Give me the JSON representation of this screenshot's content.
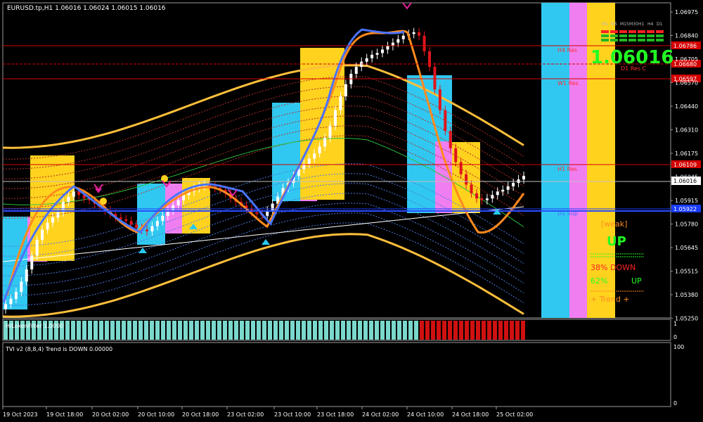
{
  "header": {
    "symbol_info": "EURUSD.tp,H1  1.06016 1.06024 1.06015 1.06016"
  },
  "price_axis": {
    "ticks": [
      "1.06975",
      "1.06840",
      "1.06705",
      "1.06570",
      "1.06440",
      "1.06310",
      "1.06175",
      "1.06045",
      "1.05915",
      "1.05780",
      "1.05645",
      "1.05515",
      "1.05380",
      "1.05250"
    ],
    "current_price": "1.06016"
  },
  "levels": [
    {
      "name": "H4 Res",
      "price": "1.06786",
      "color": "#d40000",
      "label": "H4 Res"
    },
    {
      "name": "D1 Res C",
      "price": "1.06680",
      "color": "#d40000",
      "label": "D1 Res C"
    },
    {
      "name": "W1 Res",
      "price": "1.06597",
      "color": "#d40000",
      "label": "W1 Res"
    },
    {
      "name": "H1 Res",
      "price": "1.06109",
      "color": "#d40000",
      "label": "H1 Res"
    },
    {
      "name": "D1 Sup",
      "price": "1.05922",
      "color": "#1a3cff",
      "label": "D1 Sup"
    }
  ],
  "big_price": "1.06016",
  "timeframes": [
    "M1",
    "M5",
    "M15",
    "M30",
    "H1",
    "H4",
    "D1"
  ],
  "signal_panel": {
    "weak": "[weak]",
    "up_big": "UP",
    "down_line": "38%  DOWN",
    "pct_up": "62%",
    "up_small": "UP",
    "trend": "+ Trend +"
  },
  "hilo": {
    "label": "HiLokenFilter 1.0000",
    "axis": [
      "1",
      "0"
    ]
  },
  "tvi": {
    "label": "TVI v2 (8,8,4) Trend is DOWN 0.00000",
    "axis": [
      "100",
      "0"
    ]
  },
  "time_axis": [
    "19 Oct 2023",
    "19 Oct 18:00",
    "20 Oct 02:00",
    "20 Oct 10:00",
    "20 Oct 18:00",
    "23 Oct 02:00",
    "23 Oct 10:00",
    "23 Oct 18:00",
    "24 Oct 02:00",
    "24 Oct 10:00",
    "24 Oct 18:00",
    "25 Oct 02:00"
  ],
  "chart_data": {
    "type": "candlestick",
    "title": "EURUSD.tp,H1",
    "y_range": [
      1.052,
      1.0702
    ],
    "close_series": [
      1.0528,
      1.0531,
      1.0535,
      1.0541,
      1.0548,
      1.0556,
      1.0565,
      1.0571,
      1.0575,
      1.0578,
      1.0581,
      1.0587,
      1.059,
      1.0593,
      1.0591,
      1.0589,
      1.0588,
      1.0586,
      1.0584,
      1.0582,
      1.058,
      1.0578,
      1.0577,
      1.0576,
      1.0574,
      1.0572,
      1.0571,
      1.057,
      1.0573,
      1.0576,
      1.0579,
      1.0582,
      1.0585,
      1.0588,
      1.0591,
      1.0593,
      1.0595,
      1.0596,
      1.0597,
      1.0596,
      1.0595,
      1.0594,
      1.0592,
      1.0589,
      1.0587,
      1.0585,
      1.0583,
      1.0581,
      1.058,
      1.0579,
      1.0582,
      1.0586,
      1.059,
      1.0595,
      1.0598,
      1.0602,
      1.0606,
      1.0609,
      1.0612,
      1.0615,
      1.0619,
      1.0624,
      1.0631,
      1.064,
      1.0648,
      1.0655,
      1.0661,
      1.0665,
      1.0668,
      1.067,
      1.0672,
      1.0673,
      1.0675,
      1.0677,
      1.0679,
      1.0681,
      1.0683,
      1.0684,
      1.0685,
      1.0683,
      1.0674,
      1.0665,
      1.0652,
      1.064,
      1.0628,
      1.0618,
      1.061,
      1.0603,
      1.0597,
      1.0592,
      1.0589,
      1.0588,
      1.0589,
      1.0591,
      1.0593,
      1.0594,
      1.0596,
      1.0598,
      1.06,
      1.0602
    ]
  }
}
